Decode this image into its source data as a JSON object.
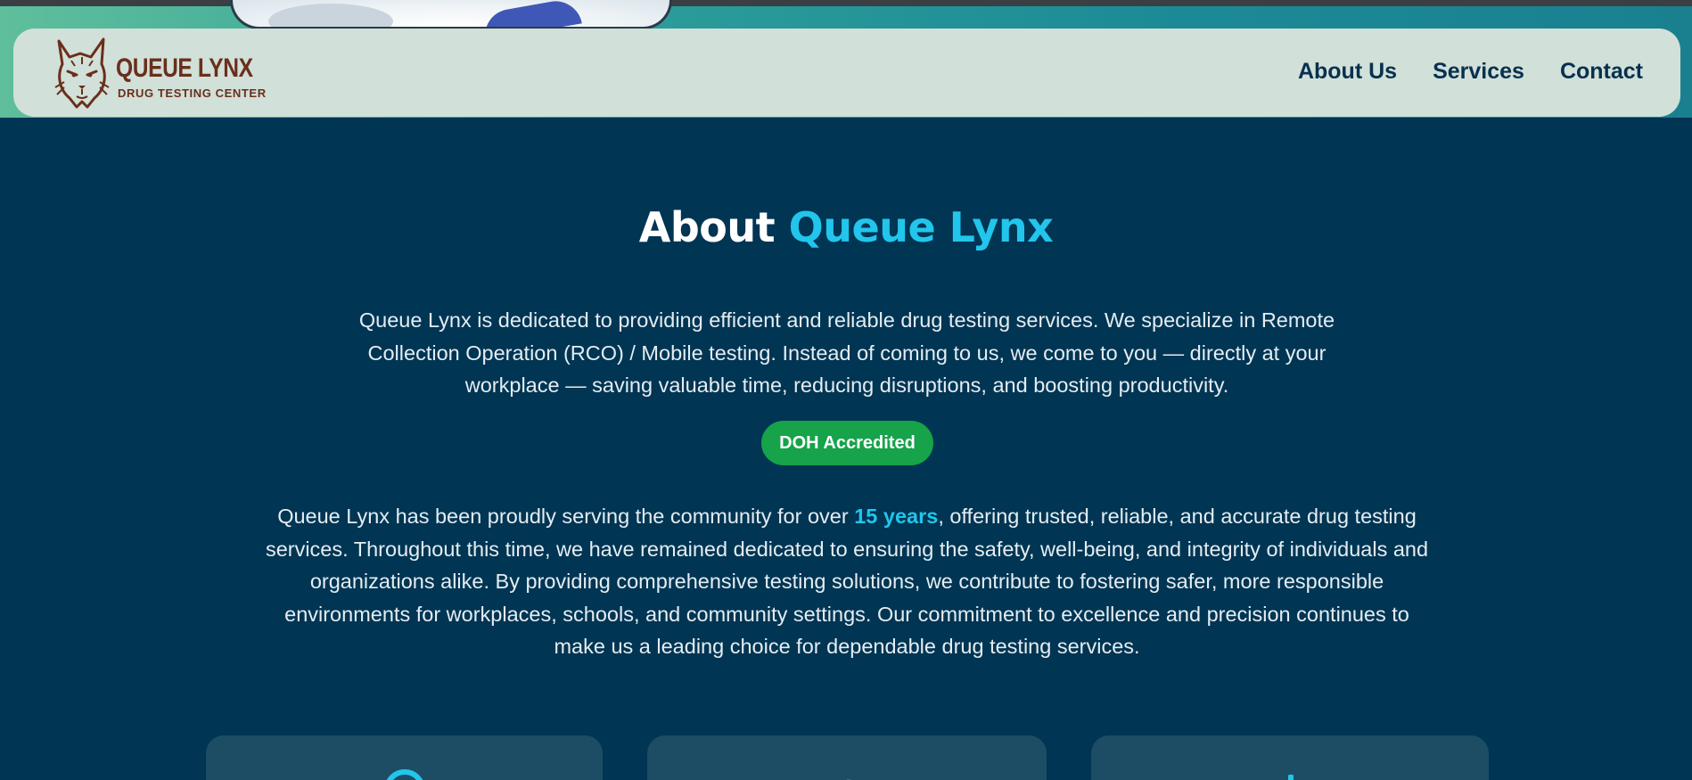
{
  "brand": {
    "name": "QUEUE LYNX",
    "tagline": "DRUG TESTING CENTER",
    "logo_icon": "lynx-head-icon",
    "color": "#6a2f1b"
  },
  "nav": {
    "items": [
      {
        "label": "About Us"
      },
      {
        "label": "Services"
      },
      {
        "label": "Contact"
      }
    ]
  },
  "about": {
    "title_prefix": "About",
    "title_accent": "Queue Lynx",
    "paragraph1": "Queue Lynx is dedicated to providing efficient and reliable drug testing services. We specialize in Remote Collection Operation (RCO) / Mobile testing. Instead of coming to us, we come to you — directly at your workplace — saving valuable time, reducing disruptions, and boosting productivity.",
    "badge": "DOH Accredited",
    "paragraph2_before": "Queue Lynx has been proudly serving the community for over ",
    "paragraph2_highlight": "15 years",
    "paragraph2_after": ", offering trusted, reliable, and accurate drug testing services. Throughout this time, we have remained dedicated to ensuring the safety, well-being, and integrity of individuals and organizations alike. By providing comprehensive testing solutions, we contribute to fostering safer, more responsible environments for workplaces, schools, and community settings. Our commitment to excellence and precision continues to make us a leading choice for dependable drug testing services."
  },
  "colors": {
    "background": "#003553",
    "accent": "#22c5ec",
    "badge": "#16a34a",
    "navbar": "#d1e0d8",
    "card": "#1d4d65"
  }
}
